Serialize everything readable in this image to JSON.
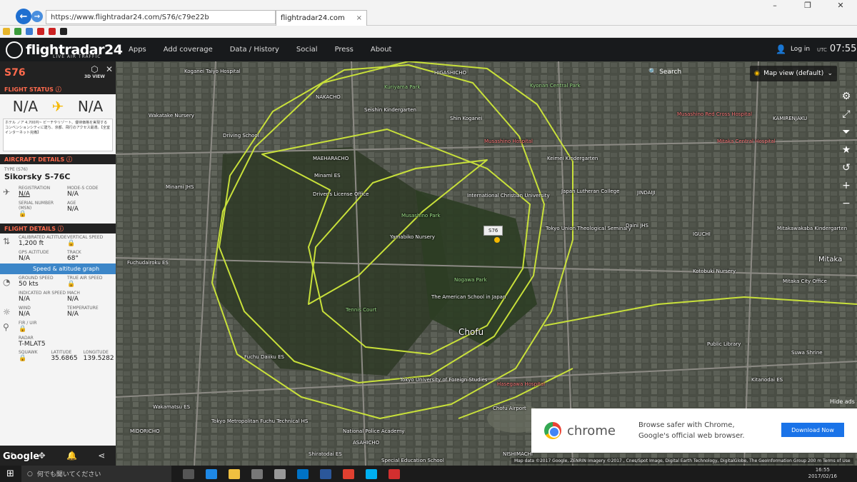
{
  "browser": {
    "url": "https://www.flightradar24.com/S76/c79e22b",
    "tab_title": "flightradar24.com",
    "window_controls": [
      "–",
      "❐",
      "✕"
    ]
  },
  "header": {
    "logo": "flightradar24",
    "logo_sub": "LIVE AIR TRAFFIC",
    "nav": [
      "Apps",
      "Add coverage",
      "Data / History",
      "Social",
      "Press",
      "About"
    ],
    "login": "Log in",
    "tz": "UTC",
    "time": "07:55"
  },
  "panel": {
    "callsign": "S76",
    "view3d": "3D VIEW",
    "flight_status_label": "FLIGHT STATUS",
    "origin": "N/A",
    "destination": "N/A",
    "ad_text": "ホテル ノア  4,700円~ ビーチやリゾート、優待価格を実現するコンベンションシティに建ち、京都、飛行のアクセス最適。【全室インターネット完備】",
    "aircraft_details_label": "AIRCRAFT DETAILS",
    "type_label": "TYPE",
    "type_code": "(S76)",
    "type_name": "Sikorsky S-76C",
    "registration_label": "REGISTRATION",
    "registration": "N/A",
    "modes_label": "MODE-S CODE",
    "modes": "N/A",
    "serial_label": "SERIAL NUMBER (MSN)",
    "age_label": "AGE",
    "age": "N/A",
    "flight_details_label": "FLIGHT DETAILS",
    "cal_alt_label": "CALIBRATED ALTITUDE",
    "cal_alt": "1,200 ft",
    "vs_label": "VERTICAL SPEED",
    "gps_alt_label": "GPS ALTITUDE",
    "gps_alt": "N/A",
    "track_label": "TRACK",
    "track": "68°",
    "speed_graph": "Speed & altitude graph",
    "gs_label": "GROUND SPEED",
    "gs": "50 kts",
    "tas_label": "TRUE AIR SPEED",
    "ias_label": "INDICATED AIR SPEED",
    "ias": "N/A",
    "mach_label": "MACH",
    "mach": "N/A",
    "wind_label": "WIND",
    "wind": "N/A",
    "temp_label": "TEMPERATURE",
    "temp": "N/A",
    "fir_label": "FIR / UIR",
    "radar_label": "RADAR",
    "radar": "T-MLAT5",
    "squawk_label": "SQUAWK",
    "lat_label": "LATITUDE",
    "lat": "35.6865",
    "lon_label": "LONGITUDE",
    "lon": "139.5282"
  },
  "map": {
    "search": "Search",
    "map_view": "Map view (default)",
    "callout": "S76",
    "hide_ads": "Hide ads",
    "attribution": "Map data ©2017 Google, ZENRIN Imagery ©2017 , Cnes/Spot Image, Digital Earth Technology, DigitalGlobe, The GeoInformation Group    200 m    Terms of Use",
    "google": "Google",
    "track_color": "#c8e03a",
    "labels": [
      {
        "t": "Koganei Taiyo Hospital",
        "c": "w"
      },
      {
        "t": "Kuriyama Park",
        "c": "g"
      },
      {
        "t": "HIGASHICHO",
        "c": "w"
      },
      {
        "t": "Kyonan Central Park",
        "c": "g"
      },
      {
        "t": "NAKACHO",
        "c": "w"
      },
      {
        "t": "Seishin Kindergarten",
        "c": "w"
      },
      {
        "t": "Shin Koganei",
        "c": "w"
      },
      {
        "t": "Wakatake Nursery",
        "c": "w"
      },
      {
        "t": "Driving School",
        "c": "w"
      },
      {
        "t": "Musashino Hospital",
        "c": "r"
      },
      {
        "t": "MAEHARACHO",
        "c": "w"
      },
      {
        "t": "Minami ES",
        "c": "w"
      },
      {
        "t": "Keimei Kindergarten",
        "c": "w"
      },
      {
        "t": "Minami JHS",
        "c": "w"
      },
      {
        "t": "Driver's License Office",
        "c": "w"
      },
      {
        "t": "International Christian University",
        "c": "w"
      },
      {
        "t": "Japan Lutheran College",
        "c": "w"
      },
      {
        "t": "Musashino Park",
        "c": "g"
      },
      {
        "t": "Yamabiko Nursery",
        "c": "w"
      },
      {
        "t": "Tokyo Union Theological Seminary",
        "c": "w"
      },
      {
        "t": "Daini JHS",
        "c": "w"
      },
      {
        "t": "Fuchudairoku ES",
        "c": "w"
      },
      {
        "t": "Nogawa Park",
        "c": "g"
      },
      {
        "t": "The American School in Japan",
        "c": "w"
      },
      {
        "t": "Tennis Court",
        "c": "g"
      },
      {
        "t": "Chofu",
        "c": "w"
      },
      {
        "t": "Fuchu Daiiku ES",
        "c": "w"
      },
      {
        "t": "Tokyo University of Foreign Studies",
        "c": "w"
      },
      {
        "t": "Hasegawa Hospital",
        "c": "r"
      },
      {
        "t": "Chofu Airport",
        "c": "w"
      },
      {
        "t": "Wakamatsu ES",
        "c": "w"
      },
      {
        "t": "Tokyo Metropolitan Fuchu Technical HS",
        "c": "w"
      },
      {
        "t": "National Police Academy",
        "c": "w"
      },
      {
        "t": "MIDORICHO",
        "c": "w"
      },
      {
        "t": "ASAHICHO",
        "c": "w"
      },
      {
        "t": "Shiratodai ES",
        "c": "w"
      },
      {
        "t": "NISHIMACHI",
        "c": "w"
      },
      {
        "t": "Special Education School",
        "c": "w"
      },
      {
        "t": "Musashino Red Cross Hospital",
        "c": "r"
      },
      {
        "t": "Mitaka Central Hospital",
        "c": "r"
      },
      {
        "t": "KAMIRENJAKU",
        "c": "w"
      },
      {
        "t": "Mitaka City Office",
        "c": "w"
      },
      {
        "t": "Kotobuki Nursery",
        "c": "w"
      },
      {
        "t": "Mitakawakaba Kindergarten",
        "c": "w"
      },
      {
        "t": "IGUCHI",
        "c": "w"
      },
      {
        "t": "JINDAIJI",
        "c": "w"
      },
      {
        "t": "Public Library",
        "c": "w"
      },
      {
        "t": "Suwa Shrine",
        "c": "w"
      },
      {
        "t": "Kitanodai ES",
        "c": "w"
      },
      {
        "t": "Mitaka",
        "c": "w"
      }
    ]
  },
  "ad": {
    "brand": "chrome",
    "line1": "Browse safer with Chrome,",
    "line2": "Google's official web browser.",
    "button": "Download Now"
  },
  "taskbar": {
    "search": "何でも聞いてください",
    "time": "16:55",
    "date": "2017/02/16"
  }
}
